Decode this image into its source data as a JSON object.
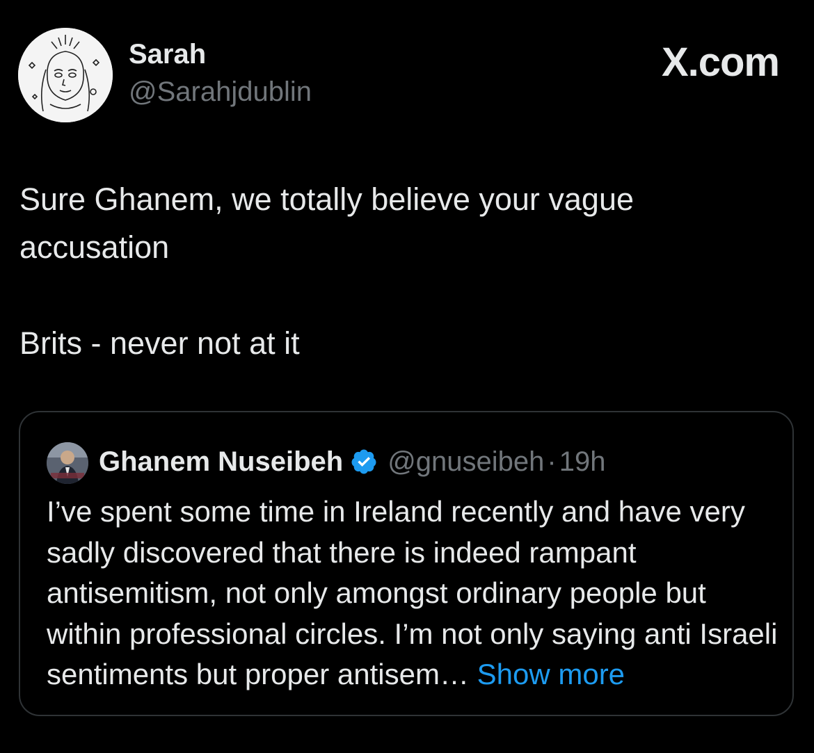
{
  "post": {
    "author": {
      "display_name": "Sarah",
      "handle": "@Sarahjdublin"
    },
    "brand": "X.com",
    "text_lines": [
      "Sure Ghanem, we totally believe your vague",
      "accusation",
      "Brits - never not at it"
    ]
  },
  "quoted_post": {
    "author": {
      "display_name": "Ghanem Nuseibeh",
      "handle": "@gnuseibeh",
      "verified": true
    },
    "separator": "·",
    "time": "19h",
    "text": "I’ve spent some time in Ireland recently and have very sadly discovered that there is indeed rampant antisemitism, not only amongst ordinary people but within professional circles. I’m not only saying anti Israeli sentiments but proper antisem…",
    "show_more_label": "Show more"
  },
  "colors": {
    "background": "#000000",
    "primary_text": "#e7e9ea",
    "secondary_text": "#71767b",
    "link": "#1d9bf0",
    "border": "#2f3336",
    "verified_badge": "#1d9bf0"
  },
  "icons": {
    "verified": "verified-badge-icon"
  }
}
